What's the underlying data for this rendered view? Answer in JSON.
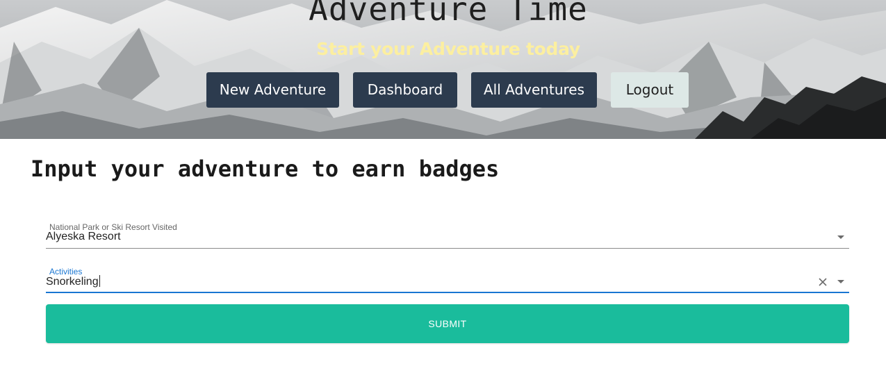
{
  "hero": {
    "title": "Adventure Time",
    "subtitle": "Start your Adventure today"
  },
  "nav": {
    "items": [
      {
        "label": "New Adventure"
      },
      {
        "label": "Dashboard"
      },
      {
        "label": "All Adventures"
      },
      {
        "label": "Logout"
      }
    ]
  },
  "main": {
    "heading": "Input your adventure to earn badges",
    "park_field": {
      "label": "National Park or Ski Resort Visited",
      "value": "Alyeska Resort"
    },
    "activities_field": {
      "label": "Activities",
      "value": "Snorkeling"
    },
    "submit_label": "SUBMIT"
  },
  "colors": {
    "nav_button": "#2c3b4e",
    "logout_button": "#dde8e6",
    "subtitle": "#fcefa0",
    "submit": "#1abc9c",
    "focus_accent": "#1976d2"
  },
  "icons": {
    "clear": "close-icon",
    "dropdown": "chevron-down-icon"
  }
}
